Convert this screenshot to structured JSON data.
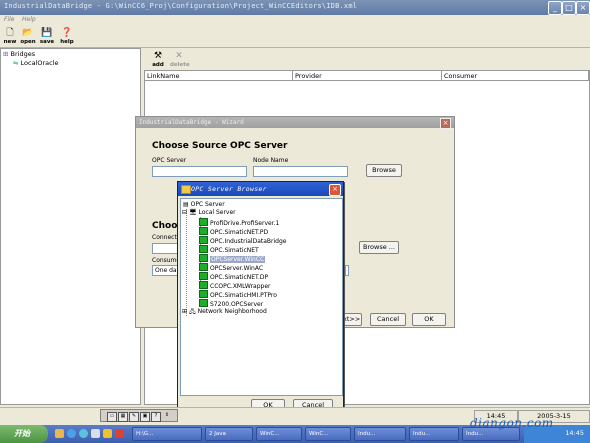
{
  "window": {
    "title": "IndustrialDataBridge - G:\\WinCC6_Proj\\Configuration\\Project_WinCCEditors\\IDB.xml"
  },
  "menu": [
    "File",
    "Help"
  ],
  "toolbar": [
    "new",
    "open",
    "save",
    "help"
  ],
  "tree": {
    "root": "Bridges",
    "child": "LocalOracle"
  },
  "right_toolbar": {
    "add": "add",
    "delete": "delete"
  },
  "grid": {
    "columns": [
      "LinkName",
      "Provider",
      "Consumer"
    ]
  },
  "wizard": {
    "title": "IndustrialDataBridge - Wizard",
    "heading_source": "Choose Source OPC Server",
    "label_opc_server": "OPC Server",
    "label_node_name": "Node Name",
    "browse": "Browse",
    "heading_target_partial": "Choos",
    "label_connection_partial": "Connectio",
    "label_consumer_partial": "Consume",
    "consumer_value_partial": "One da",
    "browse2": "Browse ...",
    "next_partial": "xt>>",
    "cancel": "Cancel",
    "ok": "OK"
  },
  "browser": {
    "title": "OPC Server Browser",
    "root": "OPC Server",
    "local": "Local Server",
    "servers": [
      "ProfiDrive.ProfiServer.1",
      "OPC.SimaticNET.PD",
      "OPC.IndustrialDataBridge",
      "OPC.SimaticNET",
      "OPCServer.WinCC",
      "OPCServer.WinAC",
      "OPC.SimaticNET.DP",
      "CCOPC.XMLWrapper",
      "OPC.SimaticHMI.PTPro",
      "S7200.OPCServer"
    ],
    "selected_index": 4,
    "network": "Network Neighborhood",
    "ok": "OK",
    "cancel": "Cancel"
  },
  "status": {
    "time": "14:45",
    "date": "2005-3-15"
  },
  "taskbar": {
    "start": "开始",
    "tasks": [
      "H:\\G...",
      "2 Java",
      "WinC...",
      "WinC...",
      "Indu...",
      "Indu...",
      "Indu..."
    ],
    "clock": "14:45"
  },
  "watermark": "diangon.com"
}
